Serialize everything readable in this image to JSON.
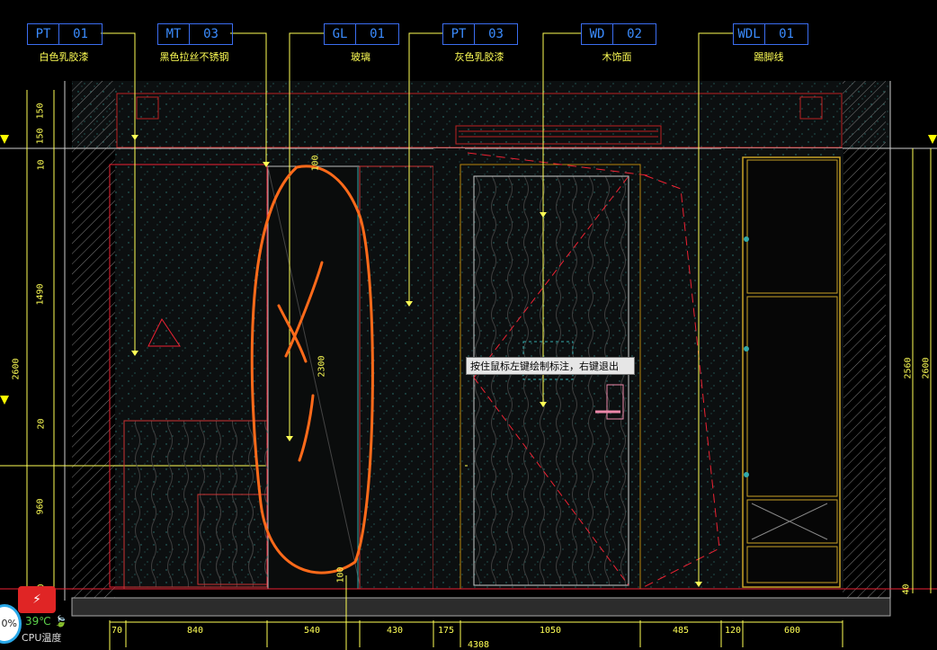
{
  "tags": [
    {
      "code": "PT",
      "num": "01",
      "desc": "白色乳胶漆"
    },
    {
      "code": "MT",
      "num": "03",
      "desc": "黑色拉丝不锈钢"
    },
    {
      "code": "GL",
      "num": "01",
      "desc": "玻璃"
    },
    {
      "code": "PT",
      "num": "03",
      "desc": "灰色乳胶漆"
    },
    {
      "code": "WD",
      "num": "02",
      "desc": "木饰面"
    },
    {
      "code": "WDL",
      "num": "01",
      "desc": "踢脚线"
    }
  ],
  "hint_text": "按住鼠标左键绘制标注，右键退出",
  "dims_bottom": [
    "70",
    "840",
    "540",
    "430",
    "175",
    "1050",
    "485",
    "120",
    "600"
  ],
  "dim_total_partial": "4308",
  "dims_left": [
    "150",
    "150",
    "10",
    "1490",
    "20",
    "960",
    "40"
  ],
  "dim_left_total": "2600",
  "dims_right": [
    "2560",
    "2600",
    "40"
  ],
  "dims_inner": [
    "100",
    "2300",
    "100"
  ],
  "widget": {
    "percent": "0%",
    "temp": "39℃",
    "label": "CPU温度",
    "badge_icon": "⚡"
  },
  "colors": {
    "background": "#000000",
    "dim": "#ffff55",
    "tag": "#3b8cff",
    "annotation": "#ff6a1a"
  }
}
